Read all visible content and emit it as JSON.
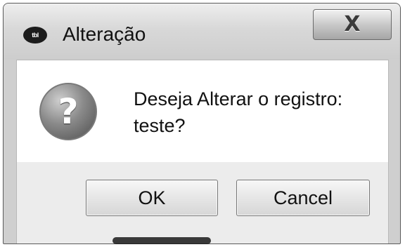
{
  "window": {
    "title": "Alteração",
    "app_icon_glyph": "tbl",
    "close_label": "X"
  },
  "message": {
    "line1": "Deseja Alterar o registro:",
    "line2": "teste?"
  },
  "icons": {
    "app": "app-logo-icon",
    "question": "question-icon",
    "question_glyph": "?"
  },
  "buttons": {
    "ok_label": "OK",
    "cancel_label": "Cancel"
  }
}
